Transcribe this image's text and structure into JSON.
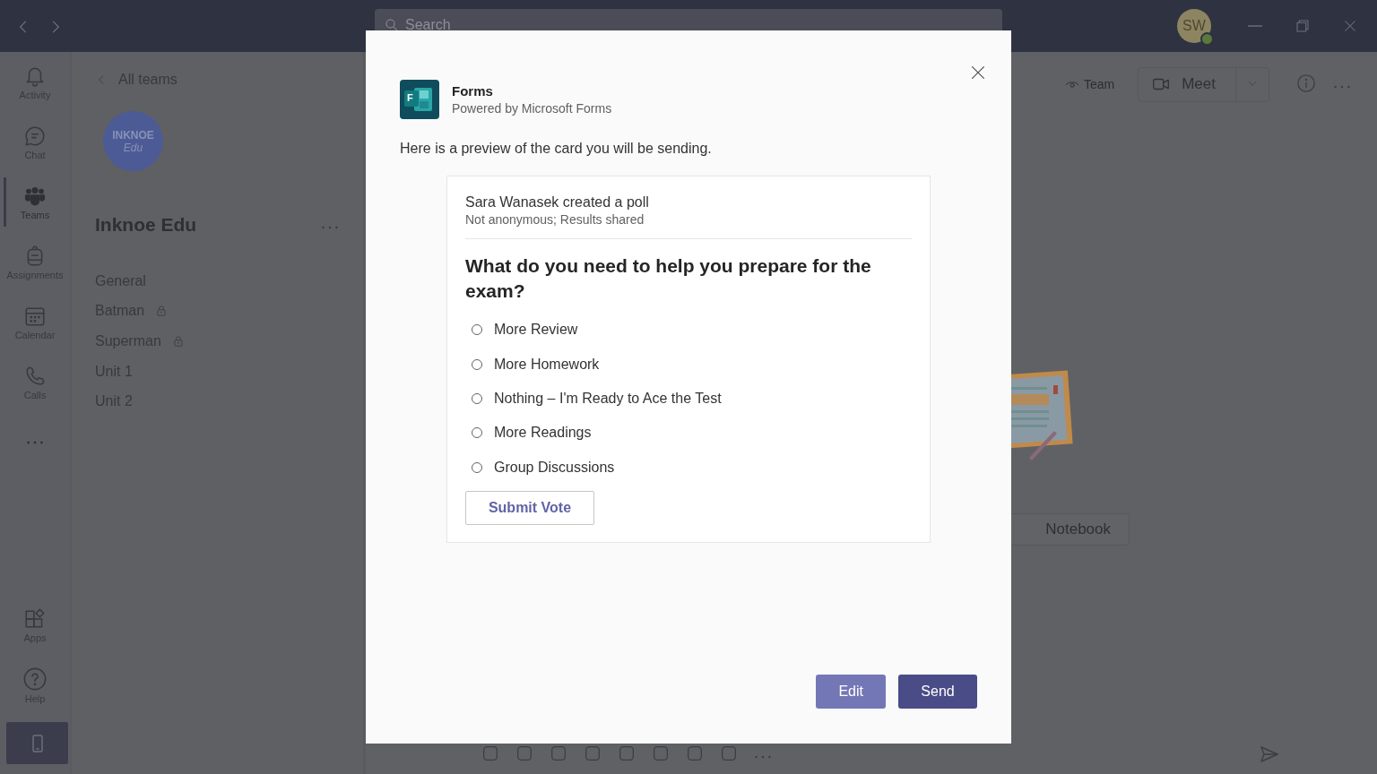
{
  "title_bar": {
    "search": {
      "placeholder": "Search"
    },
    "avatar": {
      "initials": "SW"
    }
  },
  "rail": {
    "items": [
      {
        "label": "Activity",
        "selected": false
      },
      {
        "label": "Chat",
        "selected": false
      },
      {
        "label": "Teams",
        "selected": true
      },
      {
        "label": "Assignments",
        "selected": false
      },
      {
        "label": "Calendar",
        "selected": false
      },
      {
        "label": "Calls",
        "selected": false
      }
    ],
    "bottom_items": [
      {
        "label": "Apps"
      },
      {
        "label": "Help"
      }
    ]
  },
  "team_panel": {
    "back_label": "All teams",
    "avatar": {
      "line_1": "INKNOE",
      "line_2": "Edu"
    },
    "name": "Inknoe Edu",
    "channels": [
      {
        "name": "General",
        "locked": false
      },
      {
        "name": "Batman",
        "locked": true
      },
      {
        "name": "Superman",
        "locked": true
      },
      {
        "name": "Unit 1",
        "locked": false
      },
      {
        "name": "Unit 2",
        "locked": false
      }
    ]
  },
  "header": {
    "team_label": "Team",
    "meet_label": "Meet"
  },
  "empty_state": {
    "notebook_button": "Notebook"
  },
  "dialog": {
    "app_logo_letter": "F",
    "app_name": "Forms",
    "app_subtitle": "Powered by Microsoft Forms",
    "intro": "Here is a preview of the card you will be sending.",
    "card": {
      "author_line": "Sara Wanasek created a poll",
      "settings_line": "Not anonymous; Results shared",
      "question": "What do you need to help you prepare for the exam?",
      "options": [
        {
          "label": "More Review",
          "selected": false
        },
        {
          "label": "More Homework",
          "selected": false
        },
        {
          "label": "Nothing – I'm Ready to Ace the Test",
          "selected": false
        },
        {
          "label": "More Readings",
          "selected": false
        },
        {
          "label": "Group Discussions",
          "selected": false
        }
      ],
      "submit_label": "Submit Vote"
    },
    "buttons": [
      {
        "label": "Edit",
        "kind": "secondary"
      },
      {
        "label": "Send",
        "kind": "primary"
      }
    ]
  }
}
